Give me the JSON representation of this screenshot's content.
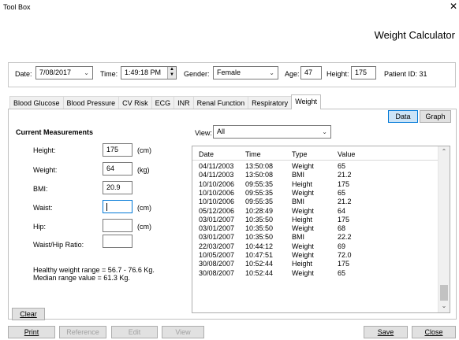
{
  "window": {
    "title": "Tool Box",
    "close_glyph": "✕"
  },
  "app_title": "Weight Calculator",
  "header": {
    "date_label": "Date:",
    "date_value": "7/08/2017",
    "time_label": "Time:",
    "time_value": "1:49:18 PM",
    "gender_label": "Gender:",
    "gender_value": "Female",
    "age_label": "Age:",
    "age_value": "47",
    "height_label": "Height:",
    "height_value": "175",
    "patient_id": "Patient ID: 31"
  },
  "tabs": [
    "Blood Glucose",
    "Blood Pressure",
    "CV Risk",
    "ECG",
    "INR",
    "Renal Function",
    "Respiratory",
    "Weight"
  ],
  "active_tab": "Weight",
  "view_buttons": {
    "data": "Data",
    "graph": "Graph",
    "selected": "Data"
  },
  "measurements": {
    "title": "Current Measurements",
    "height_label": "Height:",
    "height_value": "175",
    "height_unit": "(cm)",
    "weight_label": "Weight:",
    "weight_value": "64",
    "weight_unit": "(kg)",
    "bmi_label": "BMI:",
    "bmi_value": "20.9",
    "waist_label": "Waist:",
    "waist_value": "",
    "waist_unit": "(cm)",
    "hip_label": "Hip:",
    "hip_value": "",
    "hip_unit": "(cm)",
    "ratio_label": "Waist/Hip Ratio:",
    "ratio_value": "",
    "healthy_range": "Healthy weight range = 56.7 - 76.6 Kg.",
    "median_range": "Median range value = 61.3 Kg."
  },
  "view_filter": {
    "label": "View:",
    "value": "All"
  },
  "grid": {
    "columns": [
      "Date",
      "Time",
      "Type",
      "Value"
    ],
    "rows": [
      [
        "04/11/2003",
        "13:50:08",
        "Weight",
        "65"
      ],
      [
        "04/11/2003",
        "13:50:08",
        "BMI",
        "21.2"
      ],
      [
        "10/10/2006",
        "09:55:35",
        "Height",
        "175"
      ],
      [
        "10/10/2006",
        "09:55:35",
        "Weight",
        "65"
      ],
      [
        "10/10/2006",
        "09:55:35",
        "BMI",
        "21.2"
      ],
      [
        "05/12/2006",
        "10:28:49",
        "Weight",
        "64"
      ],
      [
        "03/01/2007",
        "10:35:50",
        "Height",
        "175"
      ],
      [
        "03/01/2007",
        "10:35:50",
        "Weight",
        "68"
      ],
      [
        "03/01/2007",
        "10:35:50",
        "BMI",
        "22.2"
      ],
      [
        "22/03/2007",
        "10:44:12",
        "Weight",
        "69"
      ],
      [
        "10/05/2007",
        "10:47:51",
        "Weight",
        "72.0"
      ],
      [
        "30/08/2007",
        "10:52:44",
        "Height",
        "175"
      ],
      [
        "30/08/2007",
        "10:52:44",
        "Weight",
        "65"
      ]
    ]
  },
  "buttons": {
    "clear": "Clear",
    "print": "Print",
    "reference": "Reference",
    "edit": "Edit",
    "view": "View",
    "save": "Save",
    "close": "Close"
  }
}
